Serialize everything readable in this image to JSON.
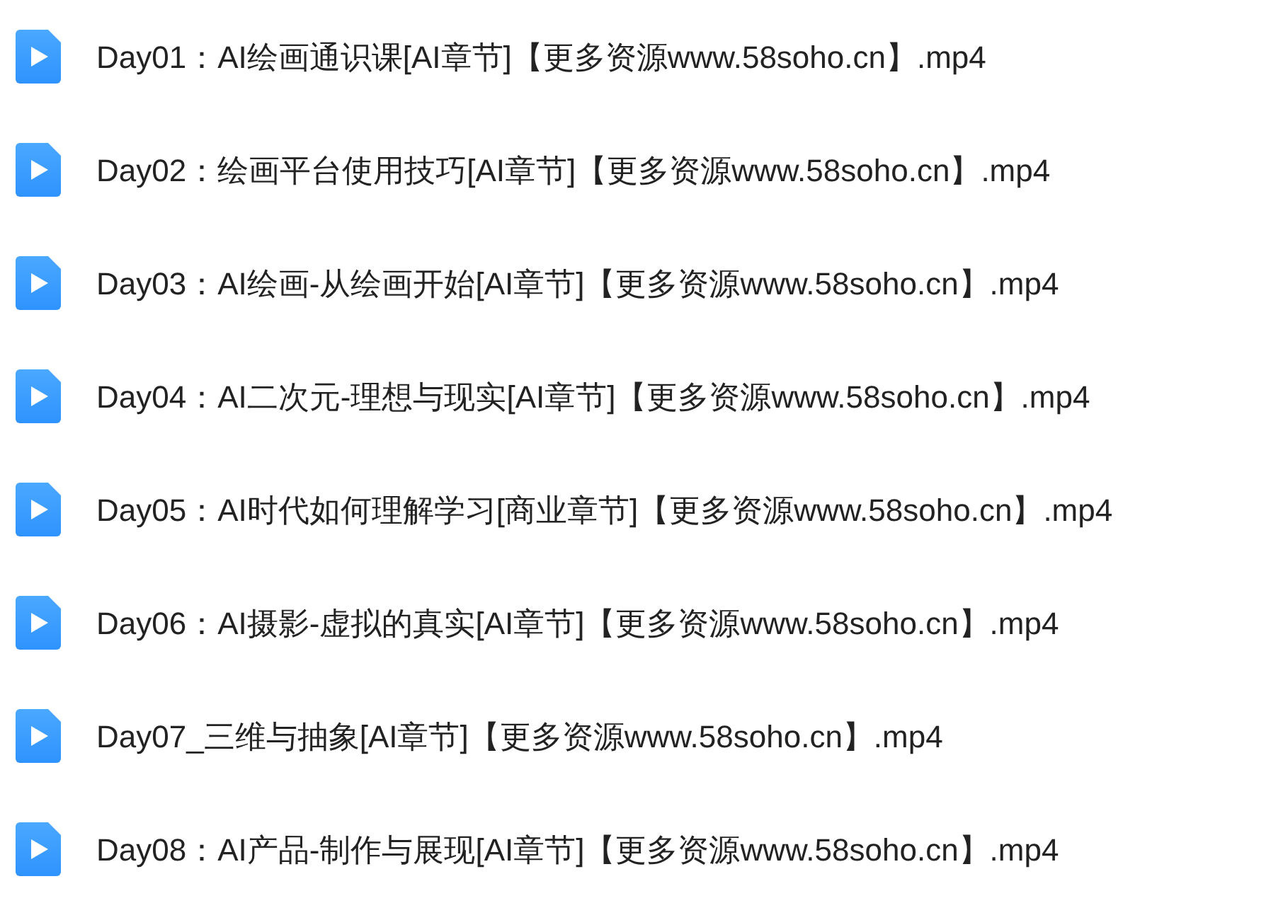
{
  "files": [
    {
      "name": "Day01：AI绘画通识课[AI章节]【更多资源www.58soho.cn】.mp4"
    },
    {
      "name": "Day02：绘画平台使用技巧[AI章节]【更多资源www.58soho.cn】.mp4"
    },
    {
      "name": "Day03：AI绘画-从绘画开始[AI章节]【更多资源www.58soho.cn】.mp4"
    },
    {
      "name": "Day04：AI二次元-理想与现实[AI章节]【更多资源www.58soho.cn】.mp4"
    },
    {
      "name": "Day05：AI时代如何理解学习[商业章节]【更多资源www.58soho.cn】.mp4"
    },
    {
      "name": "Day06：AI摄影-虚拟的真实[AI章节]【更多资源www.58soho.cn】.mp4"
    },
    {
      "name": "Day07_三维与抽象[AI章节]【更多资源www.58soho.cn】.mp4"
    },
    {
      "name": "Day08：AI产品-制作与展现[AI章节]【更多资源www.58soho.cn】.mp4"
    }
  ]
}
